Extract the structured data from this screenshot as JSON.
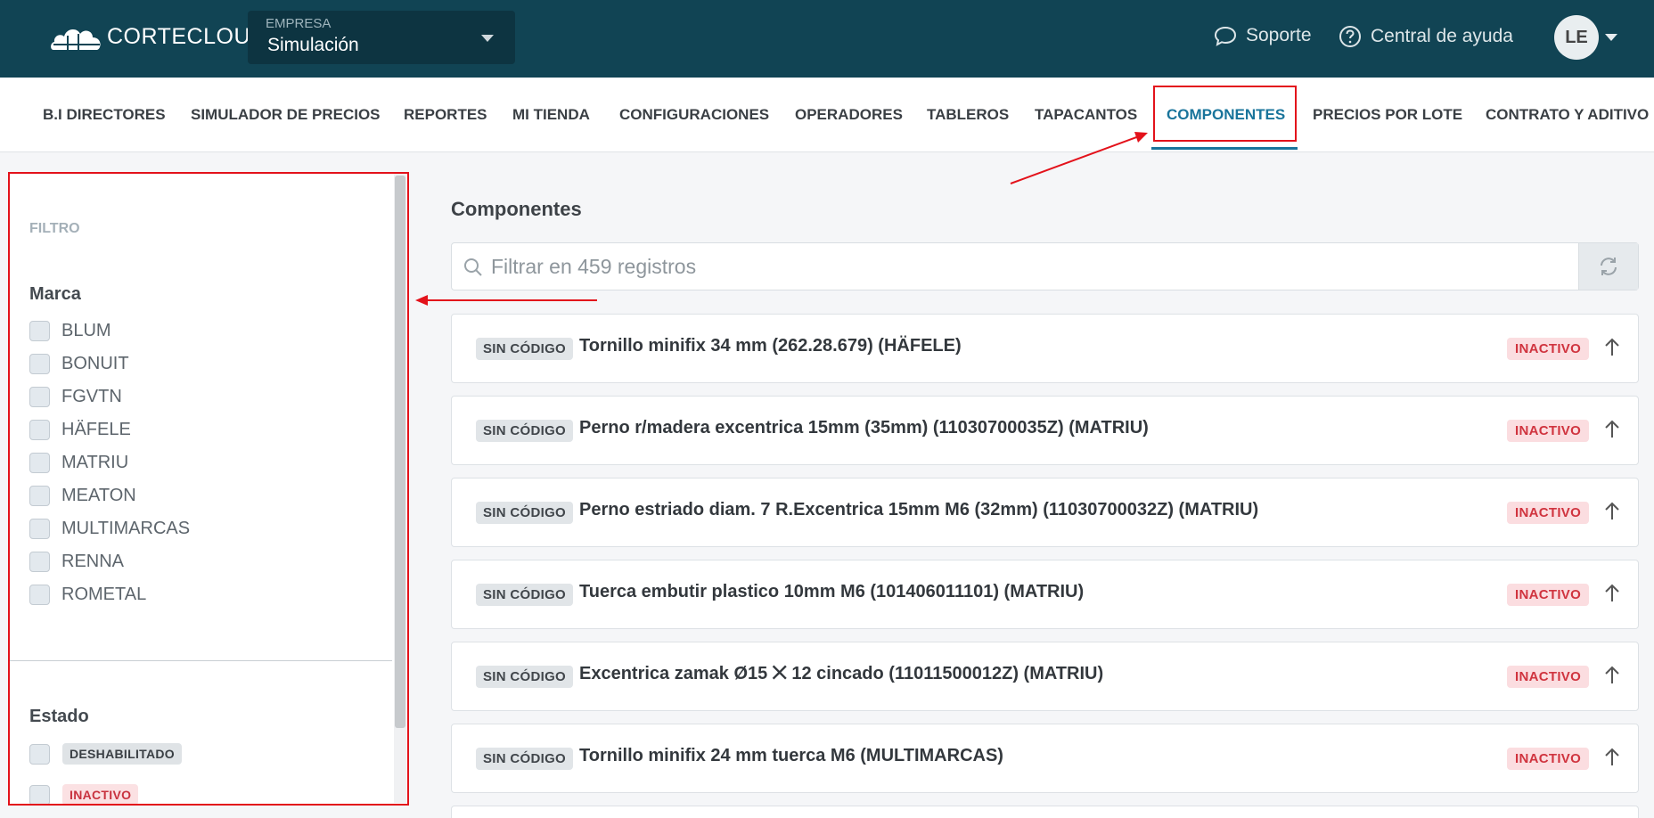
{
  "header": {
    "brand": "CORTECLOUD",
    "empresa_label": "EMPRESA",
    "empresa_value": "Simulación",
    "soporte": "Soporte",
    "ayuda": "Central de ayuda",
    "avatar": "LE",
    "colors": {
      "bg": "#114454",
      "empresa_bg": "#0d3441"
    }
  },
  "nav": {
    "items": [
      "B.I DIRECTORES",
      "SIMULADOR DE PRECIOS",
      "REPORTES",
      "MI TIENDA",
      "CONFIGURACIONES",
      "OPERADORES",
      "TABLEROS",
      "TAPACANTOS",
      "COMPONENTES",
      "PRECIOS POR LOTE",
      "CONTRATO Y ADITIVO"
    ],
    "active": "COMPONENTES",
    "active_color": "#19749b"
  },
  "sidebar": {
    "filtro_label": "FILTRO",
    "marca_title": "Marca",
    "marcas": [
      "BLUM",
      "BONUIT",
      "FGVTN",
      "HÄFELE",
      "MATRIU",
      "MEATON",
      "MULTIMARCAS",
      "RENNA",
      "ROMETAL"
    ],
    "estado_title": "Estado",
    "estados": [
      "DESHABILITADO",
      "INACTIVO"
    ]
  },
  "main": {
    "title": "Componentes",
    "search_placeholder": "Filtrar en 459 registros",
    "items": [
      {
        "code": "SIN CÓDIGO",
        "name": "Tornillo minifix 34 mm (262.28.679) (HÄFELE)",
        "status": "INACTIVO"
      },
      {
        "code": "SIN CÓDIGO",
        "name": "Perno r/madera excentrica 15mm (35mm) (11030700035Z) (MATRIU)",
        "status": "INACTIVO"
      },
      {
        "code": "SIN CÓDIGO",
        "name": "Perno estriado diam. 7 R.Excentrica 15mm M6 (32mm) (11030700032Z) (MATRIU)",
        "status": "INACTIVO"
      },
      {
        "code": "SIN CÓDIGO",
        "name": "Tuerca embutir plastico 10mm M6 (101406011101) (MATRIU)",
        "status": "INACTIVO"
      },
      {
        "code": "SIN CÓDIGO",
        "name": "Excentrica zamak Ø15 ⨉ 12 cincado (11011500012Z) (MATRIU)",
        "status": "INACTIVO"
      },
      {
        "code": "SIN CÓDIGO",
        "name": "Tornillo minifix 24 mm tuerca M6 (MULTIMARCAS)",
        "status": "INACTIVO"
      }
    ]
  },
  "annotation_color": "#e3121b"
}
